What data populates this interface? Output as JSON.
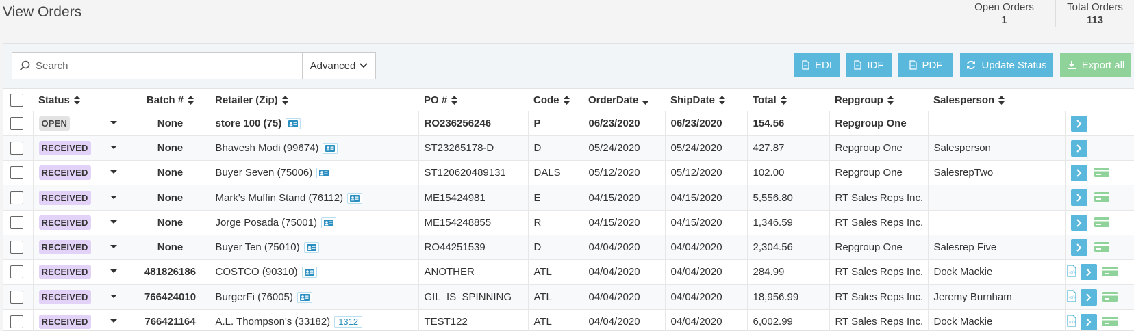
{
  "page": {
    "title": "View Orders"
  },
  "stats": {
    "open_label": "Open Orders",
    "open_value": "1",
    "total_label": "Total Orders",
    "total_value": "113"
  },
  "toolbar": {
    "search_placeholder": "Search",
    "advanced_label": "Advanced",
    "buttons": {
      "edi": "EDI",
      "idf": "IDF",
      "pdf": "PDF",
      "update_status": "Update Status",
      "export_all": "Export all"
    }
  },
  "table": {
    "headers": {
      "status": "Status",
      "batch": "Batch #",
      "retailer": "Retailer (Zip)",
      "po": "PO #",
      "code": "Code",
      "order_date": "OrderDate",
      "ship_date": "ShipDate",
      "total": "Total",
      "repgroup": "Repgroup",
      "salesperson": "Salesperson"
    },
    "rows": [
      {
        "status": "OPEN",
        "batch": "None",
        "retailer": "store 100 (75)",
        "po": "RO236256246",
        "code": "P",
        "order_date": "06/23/2020",
        "ship_date": "06/23/2020",
        "total": "154.56",
        "repgroup": "Repgroup One",
        "salesperson": ""
      },
      {
        "status": "RECEIVED",
        "batch": "None",
        "retailer": "Bhavesh Modi (99674)",
        "po": "ST23265178-D",
        "code": "D",
        "order_date": "05/24/2020",
        "ship_date": "05/24/2020",
        "total": "427.87",
        "repgroup": "Repgroup One",
        "salesperson": "Salesperson"
      },
      {
        "status": "RECEIVED",
        "batch": "None",
        "retailer": "Buyer Seven (75006)",
        "po": "ST120620489131",
        "code": "DALS",
        "order_date": "05/12/2020",
        "ship_date": "05/12/2020",
        "total": "102.00",
        "repgroup": "Repgroup One",
        "salesperson": "SalesrepTwo"
      },
      {
        "status": "RECEIVED",
        "batch": "None",
        "retailer": "Mark's Muffin Stand (76112)",
        "po": "ME15424981",
        "code": "E",
        "order_date": "04/15/2020",
        "ship_date": "04/15/2020",
        "total": "5,556.80",
        "repgroup": "RT Sales Reps Inc.",
        "salesperson": ""
      },
      {
        "status": "RECEIVED",
        "batch": "None",
        "retailer": "Jorge Posada (75001)",
        "po": "ME154248855",
        "code": "R",
        "order_date": "04/15/2020",
        "ship_date": "04/15/2020",
        "total": "1,346.59",
        "repgroup": "RT Sales Reps Inc.",
        "salesperson": ""
      },
      {
        "status": "RECEIVED",
        "batch": "None",
        "retailer": "Buyer Ten (75010)",
        "po": "RO44251539",
        "code": "D",
        "order_date": "04/04/2020",
        "ship_date": "04/04/2020",
        "total": "2,304.56",
        "repgroup": "Repgroup One",
        "salesperson": "Salesrep Five"
      },
      {
        "status": "RECEIVED",
        "batch": "481826186",
        "retailer": "COSTCO (90310)",
        "po": "ANOTHER",
        "code": "ATL",
        "order_date": "04/04/2020",
        "ship_date": "04/04/2020",
        "total": "284.99",
        "repgroup": "RT Sales Reps Inc.",
        "salesperson": "Dock Mackie"
      },
      {
        "status": "RECEIVED",
        "batch": "766424010",
        "retailer": "BurgerFi (76005)",
        "po": "GIL_IS_SPINNING",
        "code": "ATL",
        "order_date": "04/04/2020",
        "ship_date": "04/04/2020",
        "total": "18,956.99",
        "repgroup": "RT Sales Reps Inc.",
        "salesperson": "Jeremy Burnham"
      },
      {
        "status": "RECEIVED",
        "batch": "766421164",
        "retailer": "A.L. Thompson's (33182)",
        "retailer_badge": "1312",
        "po": "TEST122",
        "code": "ATL",
        "order_date": "04/04/2020",
        "ship_date": "04/04/2020",
        "total": "6,002.99",
        "repgroup": "RT Sales Reps Inc.",
        "salesperson": "Dock Mackie"
      }
    ]
  },
  "icons": {
    "search": "search-icon",
    "chevron": "chevron-down-icon",
    "file": "file-icon",
    "refresh": "refresh-icon",
    "download": "download-icon",
    "sort": "sort-icon",
    "contact": "contact-card-icon",
    "arrow": "chevron-right-icon",
    "money": "money-icon",
    "xml": "xml-file-icon"
  },
  "colors": {
    "primary": "#5ab8dc",
    "success": "#8fd39a",
    "received": "#e3d2f7",
    "open": "#e3e3e3"
  }
}
